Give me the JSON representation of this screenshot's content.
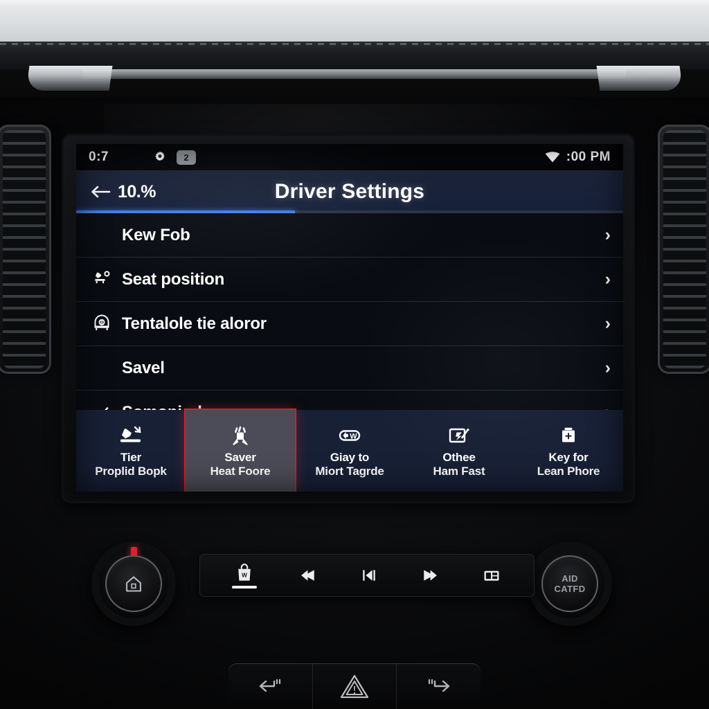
{
  "status_bar": {
    "time_left": "0:7",
    "gear_icon": "gear-icon",
    "notification_badge": "2",
    "wifi_icon": "wifi-icon",
    "clock_right": ":00 PM"
  },
  "header": {
    "back_icon": "back-arrow-icon",
    "back_label": "10.%",
    "title": "Driver Settings",
    "progress_percent": 40,
    "accent_color": "#3c7fe8"
  },
  "list": {
    "items": [
      {
        "label": "Kew Fob",
        "icon": "none",
        "chevron": "›"
      },
      {
        "label": "Seat position",
        "icon": "seat-position-icon",
        "chevron": "›"
      },
      {
        "label": "Tentalole tie aloror",
        "icon": "mirror-tilt-icon",
        "chevron": "›"
      },
      {
        "label": "Savel",
        "icon": "none",
        "chevron": "›"
      },
      {
        "label": "Somoniod",
        "icon": "check-icon",
        "chevron": "›"
      }
    ]
  },
  "tab_bar": {
    "selected_index": 1,
    "selected_border_color": "#c22634",
    "tabs": [
      {
        "icon": "seat-recline-icon",
        "line1": "Tier",
        "line2": "Proplid Bopk"
      },
      {
        "icon": "seat-heat-icon",
        "line1": "Saver",
        "line2": "Heat Foore"
      },
      {
        "icon": "steering-wheel-icon",
        "line1": "Giay to",
        "line2": "Miort Tagrde"
      },
      {
        "icon": "mirror-adjust-icon",
        "line1": "Othee",
        "line2": "Ham Fast"
      },
      {
        "icon": "add-key-icon",
        "line1": "Key for",
        "line2": "Lean Phore"
      }
    ]
  },
  "hardware": {
    "left_knob": {
      "icon": "home-icon",
      "indicator_color": "#d8222f"
    },
    "right_knob": {
      "line1": "AID",
      "line2": "CATFD"
    },
    "media_buttons": [
      {
        "icon": "radio-bag-icon",
        "active": true
      },
      {
        "icon": "rewind-icon",
        "active": false
      },
      {
        "icon": "play-pause-icon",
        "active": false
      },
      {
        "icon": "fast-forward-icon",
        "active": false
      },
      {
        "icon": "media-box-icon",
        "active": false
      }
    ],
    "physical_buttons": [
      {
        "icon": "rear-defrost-left-icon"
      },
      {
        "icon": "hazard-icon"
      },
      {
        "icon": "rear-defrost-right-icon"
      }
    ]
  }
}
